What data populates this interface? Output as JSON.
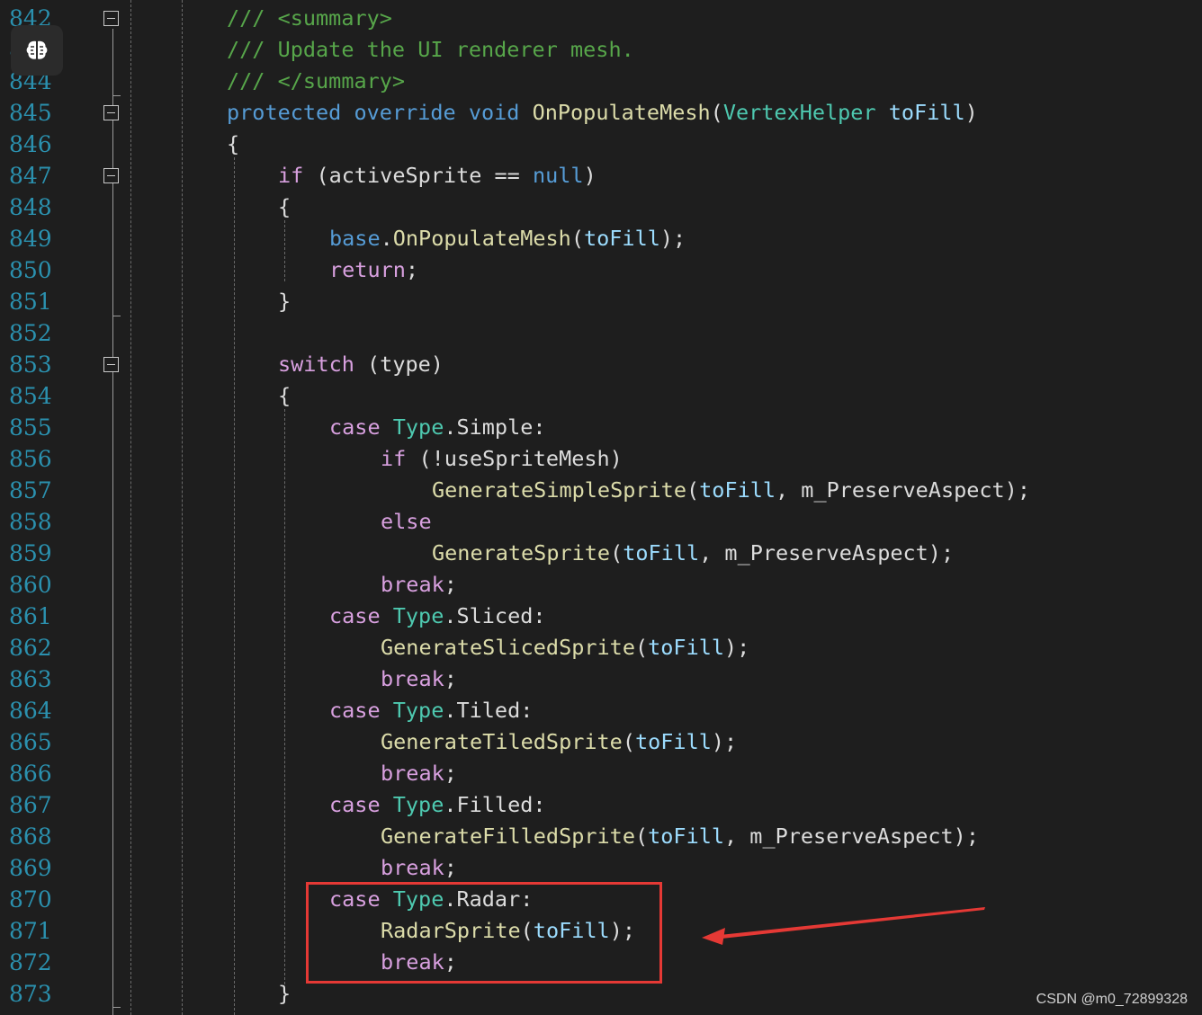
{
  "editor": {
    "lines": [
      {
        "n": "842",
        "indent": 0,
        "tokens": [
          {
            "c": "cm",
            "t": "/// <summary>"
          }
        ]
      },
      {
        "n": "843",
        "indent": 0,
        "tokens": [
          {
            "c": "cm",
            "t": "/// Update the UI renderer mesh."
          }
        ]
      },
      {
        "n": "844",
        "indent": 0,
        "tokens": [
          {
            "c": "cm",
            "t": "/// </summary>"
          }
        ]
      },
      {
        "n": "845",
        "indent": 0,
        "tokens": [
          {
            "c": "kw",
            "t": "protected"
          },
          {
            "c": "",
            "t": " "
          },
          {
            "c": "kw",
            "t": "override"
          },
          {
            "c": "",
            "t": " "
          },
          {
            "c": "kw",
            "t": "void"
          },
          {
            "c": "",
            "t": " "
          },
          {
            "c": "fn",
            "t": "OnPopulateMesh"
          },
          {
            "c": "",
            "t": "("
          },
          {
            "c": "tp",
            "t": "VertexHelper"
          },
          {
            "c": "",
            "t": " "
          },
          {
            "c": "prm",
            "t": "toFill"
          },
          {
            "c": "",
            "t": ")"
          }
        ]
      },
      {
        "n": "846",
        "indent": 0,
        "tokens": [
          {
            "c": "",
            "t": "{"
          }
        ]
      },
      {
        "n": "847",
        "indent": 1,
        "tokens": [
          {
            "c": "ctl",
            "t": "if"
          },
          {
            "c": "",
            "t": " (activeSprite == "
          },
          {
            "c": "kw",
            "t": "null"
          },
          {
            "c": "",
            "t": ")"
          }
        ]
      },
      {
        "n": "848",
        "indent": 1,
        "tokens": [
          {
            "c": "",
            "t": "{"
          }
        ]
      },
      {
        "n": "849",
        "indent": 2,
        "tokens": [
          {
            "c": "kw",
            "t": "base"
          },
          {
            "c": "",
            "t": "."
          },
          {
            "c": "fn",
            "t": "OnPopulateMesh"
          },
          {
            "c": "",
            "t": "("
          },
          {
            "c": "prm",
            "t": "toFill"
          },
          {
            "c": "",
            "t": ");"
          }
        ]
      },
      {
        "n": "850",
        "indent": 2,
        "tokens": [
          {
            "c": "ctl",
            "t": "return"
          },
          {
            "c": "",
            "t": ";"
          }
        ]
      },
      {
        "n": "851",
        "indent": 1,
        "tokens": [
          {
            "c": "",
            "t": "}"
          }
        ]
      },
      {
        "n": "852",
        "indent": 0,
        "tokens": []
      },
      {
        "n": "853",
        "indent": 1,
        "tokens": [
          {
            "c": "ctl",
            "t": "switch"
          },
          {
            "c": "",
            "t": " (type)"
          }
        ]
      },
      {
        "n": "854",
        "indent": 1,
        "tokens": [
          {
            "c": "",
            "t": "{"
          }
        ]
      },
      {
        "n": "855",
        "indent": 2,
        "tokens": [
          {
            "c": "ctl",
            "t": "case"
          },
          {
            "c": "",
            "t": " "
          },
          {
            "c": "tp",
            "t": "Type"
          },
          {
            "c": "",
            "t": ".Simple:"
          }
        ]
      },
      {
        "n": "856",
        "indent": 3,
        "tokens": [
          {
            "c": "ctl",
            "t": "if"
          },
          {
            "c": "",
            "t": " (!useSpriteMesh)"
          }
        ]
      },
      {
        "n": "857",
        "indent": 4,
        "tokens": [
          {
            "c": "fn",
            "t": "GenerateSimpleSprite"
          },
          {
            "c": "",
            "t": "("
          },
          {
            "c": "prm",
            "t": "toFill"
          },
          {
            "c": "",
            "t": ", m_PreserveAspect);"
          }
        ]
      },
      {
        "n": "858",
        "indent": 3,
        "tokens": [
          {
            "c": "ctl",
            "t": "else"
          }
        ]
      },
      {
        "n": "859",
        "indent": 4,
        "tokens": [
          {
            "c": "fn",
            "t": "GenerateSprite"
          },
          {
            "c": "",
            "t": "("
          },
          {
            "c": "prm",
            "t": "toFill"
          },
          {
            "c": "",
            "t": ", m_PreserveAspect);"
          }
        ]
      },
      {
        "n": "860",
        "indent": 3,
        "tokens": [
          {
            "c": "ctl",
            "t": "break"
          },
          {
            "c": "",
            "t": ";"
          }
        ]
      },
      {
        "n": "861",
        "indent": 2,
        "tokens": [
          {
            "c": "ctl",
            "t": "case"
          },
          {
            "c": "",
            "t": " "
          },
          {
            "c": "tp",
            "t": "Type"
          },
          {
            "c": "",
            "t": ".Sliced:"
          }
        ]
      },
      {
        "n": "862",
        "indent": 3,
        "tokens": [
          {
            "c": "fn",
            "t": "GenerateSlicedSprite"
          },
          {
            "c": "",
            "t": "("
          },
          {
            "c": "prm",
            "t": "toFill"
          },
          {
            "c": "",
            "t": ");"
          }
        ]
      },
      {
        "n": "863",
        "indent": 3,
        "tokens": [
          {
            "c": "ctl",
            "t": "break"
          },
          {
            "c": "",
            "t": ";"
          }
        ]
      },
      {
        "n": "864",
        "indent": 2,
        "tokens": [
          {
            "c": "ctl",
            "t": "case"
          },
          {
            "c": "",
            "t": " "
          },
          {
            "c": "tp",
            "t": "Type"
          },
          {
            "c": "",
            "t": ".Tiled:"
          }
        ]
      },
      {
        "n": "865",
        "indent": 3,
        "tokens": [
          {
            "c": "fn",
            "t": "GenerateTiledSprite"
          },
          {
            "c": "",
            "t": "("
          },
          {
            "c": "prm",
            "t": "toFill"
          },
          {
            "c": "",
            "t": ");"
          }
        ]
      },
      {
        "n": "866",
        "indent": 3,
        "tokens": [
          {
            "c": "ctl",
            "t": "break"
          },
          {
            "c": "",
            "t": ";"
          }
        ]
      },
      {
        "n": "867",
        "indent": 2,
        "tokens": [
          {
            "c": "ctl",
            "t": "case"
          },
          {
            "c": "",
            "t": " "
          },
          {
            "c": "tp",
            "t": "Type"
          },
          {
            "c": "",
            "t": ".Filled:"
          }
        ]
      },
      {
        "n": "868",
        "indent": 3,
        "tokens": [
          {
            "c": "fn",
            "t": "GenerateFilledSprite"
          },
          {
            "c": "",
            "t": "("
          },
          {
            "c": "prm",
            "t": "toFill"
          },
          {
            "c": "",
            "t": ", m_PreserveAspect);"
          }
        ]
      },
      {
        "n": "869",
        "indent": 3,
        "tokens": [
          {
            "c": "ctl",
            "t": "break"
          },
          {
            "c": "",
            "t": ";"
          }
        ]
      },
      {
        "n": "870",
        "indent": 2,
        "tokens": [
          {
            "c": "ctl",
            "t": "case"
          },
          {
            "c": "",
            "t": " "
          },
          {
            "c": "tp",
            "t": "Type"
          },
          {
            "c": "",
            "t": ".Radar:"
          }
        ]
      },
      {
        "n": "871",
        "indent": 3,
        "tokens": [
          {
            "c": "fn",
            "t": "RadarSprite"
          },
          {
            "c": "",
            "t": "("
          },
          {
            "c": "prm",
            "t": "toFill"
          },
          {
            "c": "",
            "t": ");"
          }
        ]
      },
      {
        "n": "872",
        "indent": 3,
        "tokens": [
          {
            "c": "ctl",
            "t": "break"
          },
          {
            "c": "",
            "t": ";"
          }
        ]
      },
      {
        "n": "873",
        "indent": 1,
        "tokens": [
          {
            "c": "",
            "t": "}"
          }
        ]
      }
    ],
    "fold_lines": [
      "842",
      "845",
      "847",
      "853"
    ]
  },
  "badge": {
    "icon": "brain-icon"
  },
  "annotation": {
    "color": "#e53935"
  },
  "watermark": {
    "text": "CSDN @m0_72899328"
  },
  "colors": {
    "background": "#1e1e1e",
    "line_number": "#2b91af",
    "keyword": "#569cd6",
    "control": "#d8a0df",
    "comment": "#57a64a",
    "type": "#4ec9b0",
    "method": "#dcdcaa",
    "parameter": "#9cdcfe",
    "text": "#dcdcdc"
  }
}
